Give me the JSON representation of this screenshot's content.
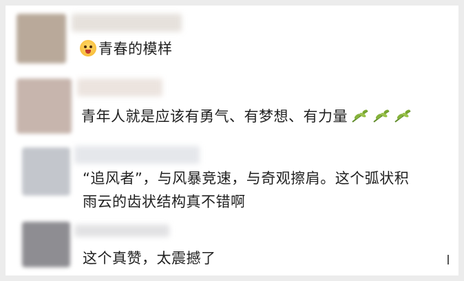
{
  "comments": [
    {
      "text": "青春的模样",
      "emoji_icon": "face-emoji-icon"
    },
    {
      "text": "青年人就是应该有勇气、有梦想、有力量",
      "trailing_icons": [
        "leaf-icon",
        "leaf-icon",
        "leaf-icon"
      ]
    },
    {
      "line1": "“追风者”，与风暴竞速，与奇观擦肩。这个弧状积",
      "line2": "雨云的齿状结构真不错啊"
    },
    {
      "text": "这个真赞，太震撼了"
    }
  ]
}
